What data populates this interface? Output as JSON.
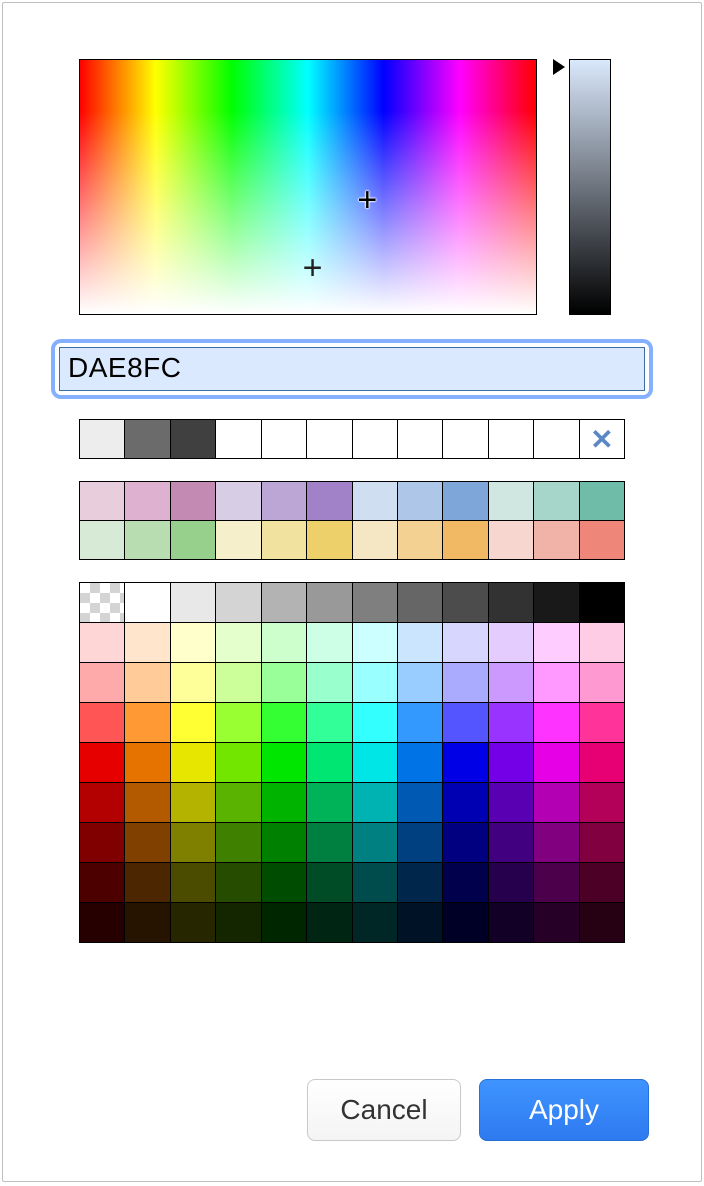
{
  "hex_input": {
    "value": "DAE8FC"
  },
  "recent_colors": [
    "#EDEDED",
    "#6B6B6B",
    "#404040",
    "#FFFFFF",
    "#FFFFFF",
    "#FFFFFF",
    "#FFFFFF",
    "#FFFFFF",
    "#FFFFFF",
    "#FFFFFF",
    "#FFFFFF"
  ],
  "preset_palette": [
    [
      "#E8CEDD",
      "#DDB1CF",
      "#C38BB4",
      "#D7CDE4",
      "#BBA6D6",
      "#A181C7",
      "#CFDEF0",
      "#AEC7E8",
      "#7FA6D9",
      "#CFE7E0",
      "#A6D5C9",
      "#6FBDA8"
    ],
    [
      "#D6EAD6",
      "#B7DDB1",
      "#97D08C",
      "#F5EFCB",
      "#F1E39F",
      "#EED06B",
      "#F6E7C4",
      "#F3D193",
      "#F1B963",
      "#F6D6CF",
      "#F1B2A7",
      "#EE867A"
    ]
  ],
  "big_palette": [
    [
      "transparent",
      "#FFFFFF",
      "#E8E8E8",
      "#D4D4D4",
      "#B3B3B3",
      "#999999",
      "#7F7F7F",
      "#666666",
      "#4C4C4C",
      "#323232",
      "#191919",
      "#000000"
    ],
    [
      "#FFD6D6",
      "#FFE5CC",
      "#FFFFCC",
      "#E5FFCC",
      "#CCFFCC",
      "#CCFFE5",
      "#CCFFFF",
      "#CCE5FF",
      "#D6D6FF",
      "#E5CCFF",
      "#FFCCFF",
      "#FFCCE5"
    ],
    [
      "#FFAAAA",
      "#FFCC99",
      "#FFFF99",
      "#CCFF99",
      "#99FF99",
      "#99FFCC",
      "#99FFFF",
      "#99CCFF",
      "#AAAAFF",
      "#CC99FF",
      "#FF99FF",
      "#FF99D1"
    ],
    [
      "#FF5555",
      "#FF9933",
      "#FFFF33",
      "#99FF33",
      "#33FF33",
      "#33FF99",
      "#33FFFF",
      "#3399FF",
      "#5555FF",
      "#9933FF",
      "#FF33FF",
      "#FF3399"
    ],
    [
      "#E60000",
      "#E67300",
      "#E6E600",
      "#73E600",
      "#00E600",
      "#00E673",
      "#00E6E6",
      "#0073E6",
      "#0000E6",
      "#7300E6",
      "#E600E6",
      "#E60073"
    ],
    [
      "#B30000",
      "#B35900",
      "#B3B300",
      "#59B300",
      "#00B300",
      "#00B359",
      "#00B3B3",
      "#0059B3",
      "#0000B3",
      "#5900B3",
      "#B300B3",
      "#B30059"
    ],
    [
      "#800000",
      "#804000",
      "#808000",
      "#408000",
      "#008000",
      "#008040",
      "#008080",
      "#004080",
      "#000080",
      "#400080",
      "#800080",
      "#800040"
    ],
    [
      "#4C0000",
      "#4C2600",
      "#4C4C00",
      "#264C00",
      "#004C00",
      "#004C26",
      "#004C4C",
      "#00264C",
      "#00004C",
      "#26004C",
      "#4C004C",
      "#4C0026"
    ],
    [
      "#260000",
      "#261300",
      "#262600",
      "#132600",
      "#002600",
      "#002613",
      "#002626",
      "#001326",
      "#000026",
      "#130026",
      "#260026",
      "#260013"
    ]
  ],
  "buttons": {
    "cancel": "Cancel",
    "apply": "Apply"
  }
}
